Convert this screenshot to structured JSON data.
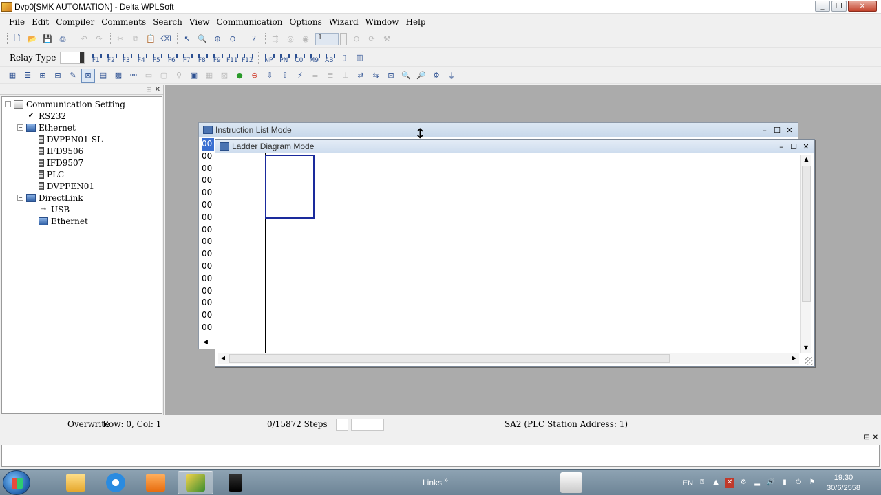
{
  "window": {
    "title": "Dvp0[SMK AUTOMATION] - Delta WPLSoft",
    "controls": [
      "_",
      "❐",
      "✕"
    ]
  },
  "menu": {
    "items": [
      "File",
      "Edit",
      "Compiler",
      "Comments",
      "Search",
      "View",
      "Communication",
      "Options",
      "Wizard",
      "Window",
      "Help"
    ]
  },
  "toolbar2": {
    "relay_type_label": "Relay Type",
    "function_keys": [
      "F1",
      "F2",
      "F3",
      "F4",
      "F5",
      "F6",
      "F7",
      "F8",
      "F9",
      "F11",
      "F12",
      "NP",
      "PN",
      "C0",
      "M9",
      "AB"
    ]
  },
  "toolbar1": {
    "step_value": "1"
  },
  "workspace_tree": {
    "items": [
      {
        "label": "Communication Setting",
        "level": 0,
        "expander": "−",
        "icon": "settings-icon"
      },
      {
        "label": "RS232",
        "level": 1,
        "expander": "",
        "icon": "check-icon"
      },
      {
        "label": "Ethernet",
        "level": 1,
        "expander": "−",
        "icon": "network-icon"
      },
      {
        "label": "DVPEN01-SL",
        "level": 2,
        "expander": "",
        "icon": "device-icon"
      },
      {
        "label": "IFD9506",
        "level": 2,
        "expander": "",
        "icon": "device-icon"
      },
      {
        "label": "IFD9507",
        "level": 2,
        "expander": "",
        "icon": "device-icon"
      },
      {
        "label": "PLC",
        "level": 2,
        "expander": "",
        "icon": "device-icon"
      },
      {
        "label": "DVPFEN01",
        "level": 2,
        "expander": "",
        "icon": "device-icon"
      },
      {
        "label": "DirectLink",
        "level": 1,
        "expander": "−",
        "icon": "directlink-icon"
      },
      {
        "label": "USB",
        "level": 2,
        "expander": "",
        "icon": "usb-icon"
      },
      {
        "label": "Ethernet",
        "level": 2,
        "expander": "",
        "icon": "network-icon"
      }
    ]
  },
  "instruction_list_window": {
    "title": "Instruction List Mode",
    "line_numbers": [
      "00",
      "00",
      "00",
      "00",
      "00",
      "00",
      "00",
      "00",
      "00",
      "00",
      "00",
      "00",
      "00",
      "00",
      "00",
      "00"
    ]
  },
  "ladder_window": {
    "title": "Ladder Diagram Mode"
  },
  "status_bar": {
    "mode": "Overwrite",
    "position": "Row: 0, Col: 1",
    "steps": "0/15872 Steps",
    "station": "SA2 (PLC Station Address: 1)"
  },
  "taskbar": {
    "links_label": "Links",
    "links_chevron": "»",
    "language": "EN",
    "time": "19:30",
    "date": "30/6/2558"
  }
}
